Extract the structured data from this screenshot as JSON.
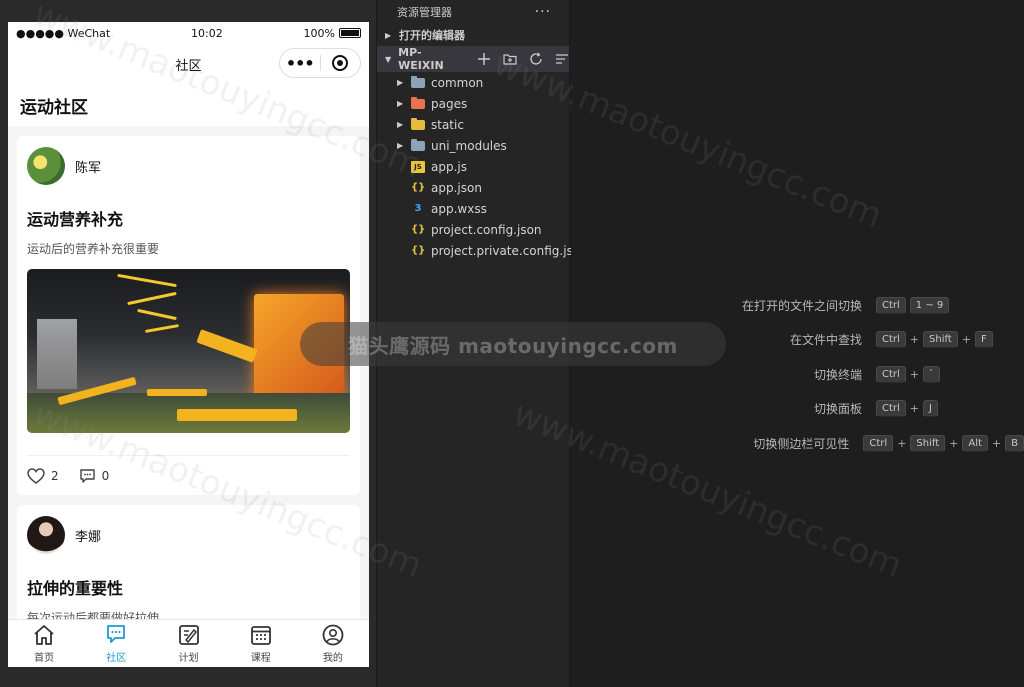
{
  "phone": {
    "status": {
      "carrier": "●●●●● WeChat",
      "time": "10:02",
      "battery": "100%"
    },
    "nav_title": "社区",
    "page_title": "运动社区",
    "posts": [
      {
        "author": "陈军",
        "title": "运动营养补充",
        "desc": "运动后的营养补充很重要",
        "likes": "2",
        "comments": "0"
      },
      {
        "author": "李娜",
        "title": "拉伸的重要性",
        "desc": "每次运动后都要做好拉伸"
      }
    ],
    "tabs": [
      {
        "label": "首页",
        "icon": "home-icon"
      },
      {
        "label": "社区",
        "icon": "community-icon",
        "active": true
      },
      {
        "label": "计划",
        "icon": "plan-icon"
      },
      {
        "label": "课程",
        "icon": "course-icon"
      },
      {
        "label": "我的",
        "icon": "profile-icon"
      }
    ]
  },
  "explorer": {
    "title": "资源管理器",
    "open_editors": "打开的编辑器",
    "root": "MP-WEIXIN",
    "folders": [
      {
        "name": "common",
        "color": "#8fa3b8"
      },
      {
        "name": "pages",
        "color": "#e8744f"
      },
      {
        "name": "static",
        "color": "#e8b93f"
      },
      {
        "name": "uni_modules",
        "color": "#8fa3b8"
      }
    ],
    "files": [
      {
        "name": "app.js",
        "icon": "JS",
        "color": "#e8c53a"
      },
      {
        "name": "app.json",
        "icon": "{}",
        "color": "#e8c53a"
      },
      {
        "name": "app.wxss",
        "icon": "3",
        "color": "#42a5f5"
      },
      {
        "name": "project.config.json",
        "icon": "{}",
        "color": "#e8c53a"
      },
      {
        "name": "project.private.config.js...",
        "icon": "{}",
        "color": "#e8c53a"
      }
    ]
  },
  "shortcuts": [
    {
      "label": "在打开的文件之间切换",
      "keys": [
        "Ctrl",
        "1 ~ 9"
      ]
    },
    {
      "label": "在文件中查找",
      "keys": [
        "Ctrl",
        "Shift",
        "F"
      ]
    },
    {
      "label": "切换终端",
      "keys": [
        "Ctrl",
        "`"
      ]
    },
    {
      "label": "切换面板",
      "keys": [
        "Ctrl",
        "J"
      ]
    },
    {
      "label": "切换侧边栏可见性",
      "keys": [
        "Ctrl",
        "Shift",
        "Alt",
        "B"
      ]
    }
  ],
  "watermark": {
    "text": "猫头鹰源码 maotouyingcc.com",
    "diagonal": "www.maotouyingcc.com"
  }
}
